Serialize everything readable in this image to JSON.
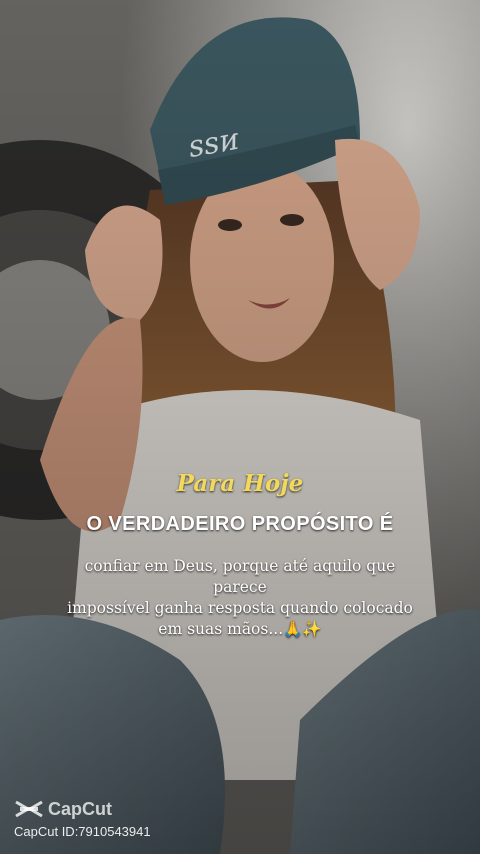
{
  "scene": {
    "description_icon": "photo-background"
  },
  "quote": {
    "kicker": "Para Hoje",
    "title": "O VERDADEIRO  PROPÓSITO É",
    "body_line1": "confiar em Deus, porque até aquilo que parece",
    "body_line2": "impossível ganha resposta quando colocado",
    "body_line3": "em suas mãos...🙏✨"
  },
  "watermark": {
    "brand": "CapCut",
    "id_text": "CapCut ID:7910543941",
    "icon": "capcut-logo-icon"
  },
  "colors": {
    "kicker": "#f2d85b",
    "beanie": "#3e5a63",
    "text": "#ffffff"
  }
}
